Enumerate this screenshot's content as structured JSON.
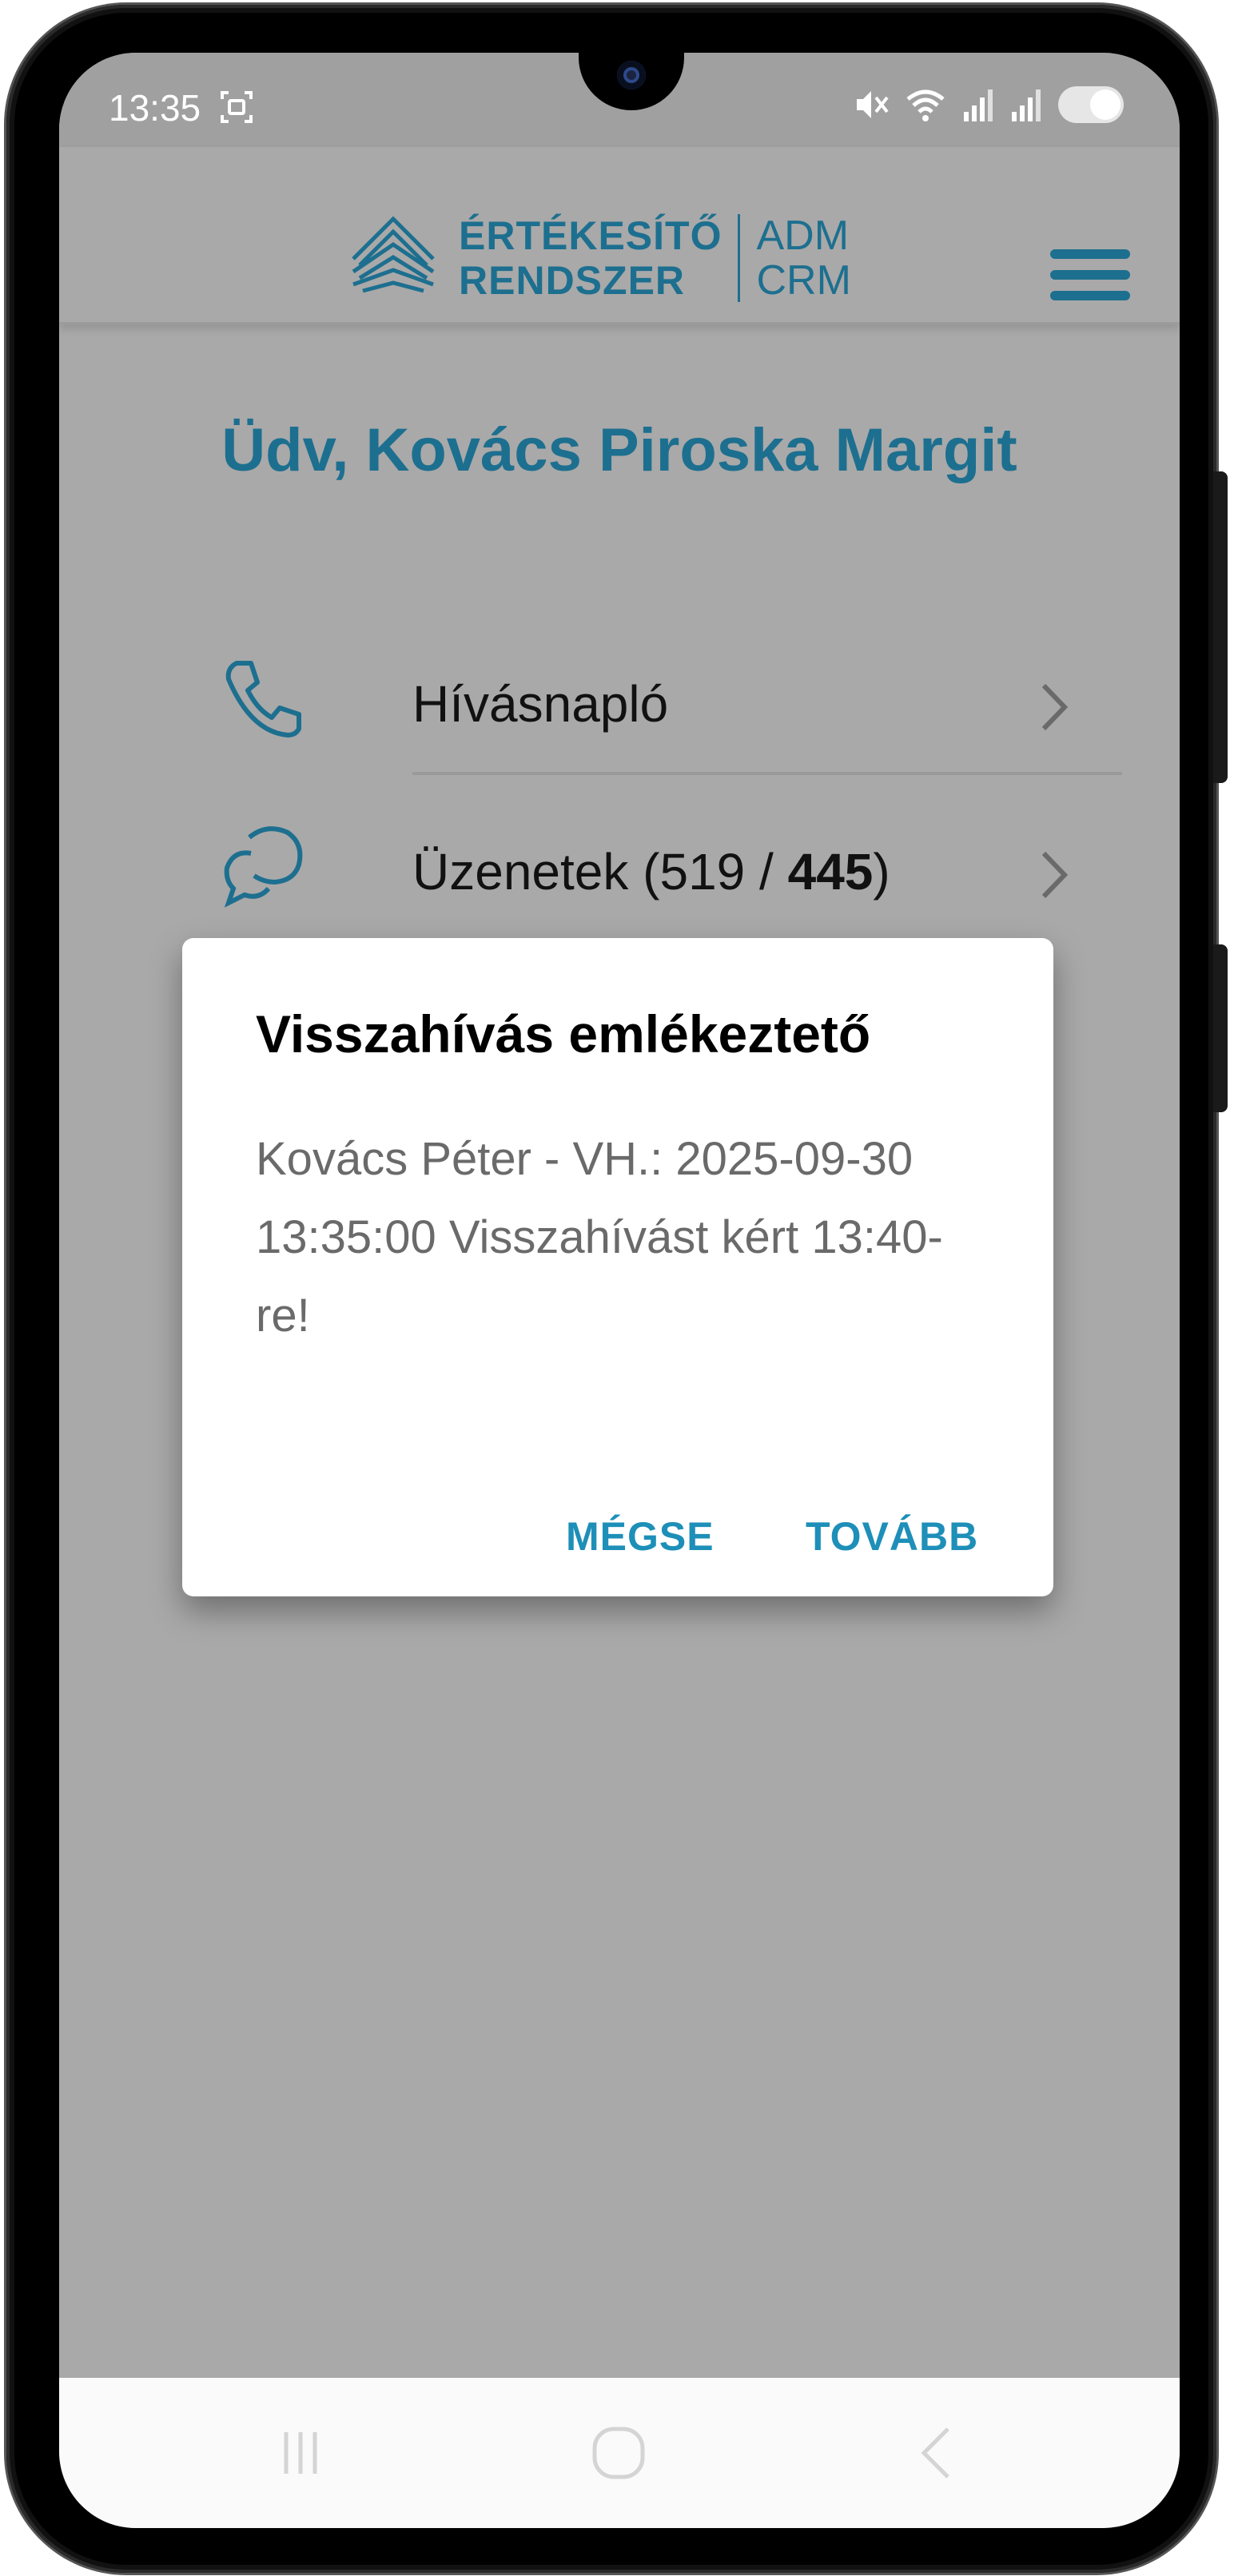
{
  "status_bar": {
    "time": "13:35",
    "icons": [
      "screenshot-icon",
      "mute-icon",
      "wifi-icon",
      "signal-icon",
      "signal-icon",
      "battery-icon"
    ]
  },
  "header": {
    "logo_line1": "ÉRTÉKESÍTŐ",
    "logo_line2": "RENDSZER",
    "logo_right1": "ADM",
    "logo_right2": "CRM",
    "menu_icon": "hamburger-menu-icon"
  },
  "greeting": {
    "text": "Üdv, Kovács Piroska Margit"
  },
  "menu": {
    "items": [
      {
        "label": "Hívásnapló",
        "icon": "phone-icon"
      },
      {
        "label": "Üzenetek (519 / ",
        "count_bold": "445",
        "suffix": ")",
        "icon": "chat-icon"
      }
    ]
  },
  "dialog": {
    "title": "Visszahívás emlékeztető",
    "body": "Kovács Péter - VH.: 2025-09-30 13:35:00 Visszahívást kért 13:40-re!",
    "cancel_label": "MÉGSE",
    "continue_label": "TOVÁBB"
  },
  "colors": {
    "brand": "#1d6f8f",
    "accent": "#1d8fb8",
    "overlay": "#a9a9a9"
  },
  "navbar": {
    "icons": [
      "recent-apps-icon",
      "home-icon",
      "back-icon"
    ]
  }
}
